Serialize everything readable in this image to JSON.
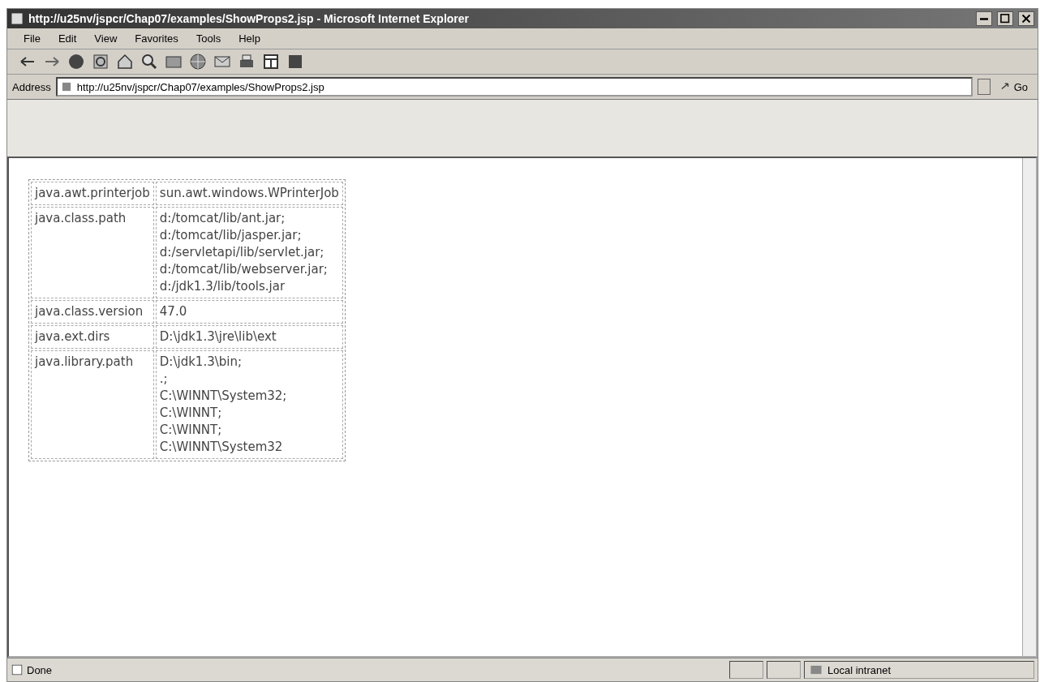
{
  "window": {
    "title": "http://u25nv/jspcr/Chap07/examples/ShowProps2.jsp - Microsoft Internet Explorer"
  },
  "menu": [
    "File",
    "Edit",
    "View",
    "Favorites",
    "Tools",
    "Help"
  ],
  "address": {
    "label": "Address",
    "value": "http://u25nv/jspcr/Chap07/examples/ShowProps2.jsp",
    "go": "Go"
  },
  "table": {
    "rows": [
      {
        "name": "java.awt.printerjob",
        "value": [
          "sun.awt.windows.WPrinterJob"
        ]
      },
      {
        "name": "java.class.path",
        "value": [
          "d:/tomcat/lib/ant.jar;",
          "d:/tomcat/lib/jasper.jar;",
          "d:/servletapi/lib/servlet.jar;",
          "d:/tomcat/lib/webserver.jar;",
          "d:/jdk1.3/lib/tools.jar"
        ]
      },
      {
        "name": "java.class.version",
        "value": [
          "47.0"
        ]
      },
      {
        "name": "java.ext.dirs",
        "value": [
          "D:\\jdk1.3\\jre\\lib\\ext"
        ]
      },
      {
        "name": "java.library.path",
        "value": [
          "D:\\jdk1.3\\bin;",
          ".;",
          "C:\\WINNT\\System32;",
          "C:\\WINNT;",
          "C:\\WINNT;",
          "C:\\WINNT\\System32"
        ]
      }
    ]
  },
  "status_bar": {
    "text": "Done",
    "zone": "Local intranet"
  }
}
